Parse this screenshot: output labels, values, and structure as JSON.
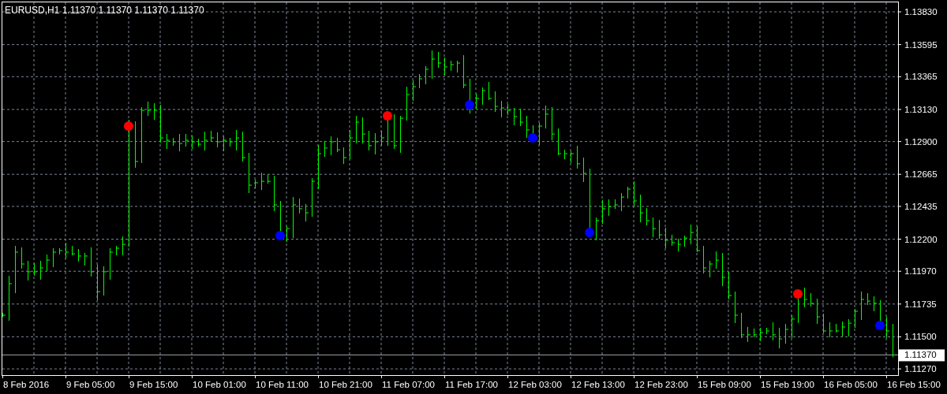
{
  "chart": {
    "title": "EURUSD,H1  1.11370 1.11370 1.11370 1.11370",
    "price_axis": [
      "1.13830",
      "1.13595",
      "1.13365",
      "1.13130",
      "1.12900",
      "1.12665",
      "1.12435",
      "1.12200",
      "1.11970",
      "1.11735",
      "1.11500",
      "1.11270"
    ],
    "current_price": "1.11370",
    "time_axis": [
      "8 Feb 2016",
      "9 Feb 05:00",
      "9 Feb 15:00",
      "10 Feb 01:00",
      "10 Feb 11:00",
      "10 Feb 21:00",
      "11 Feb 07:00",
      "11 Feb 17:00",
      "12 Feb 03:00",
      "12 Feb 13:00",
      "12 Feb 23:00",
      "15 Feb 09:00",
      "15 Feb 19:00",
      "16 Feb 05:00",
      "16 Feb 15:00"
    ]
  }
}
